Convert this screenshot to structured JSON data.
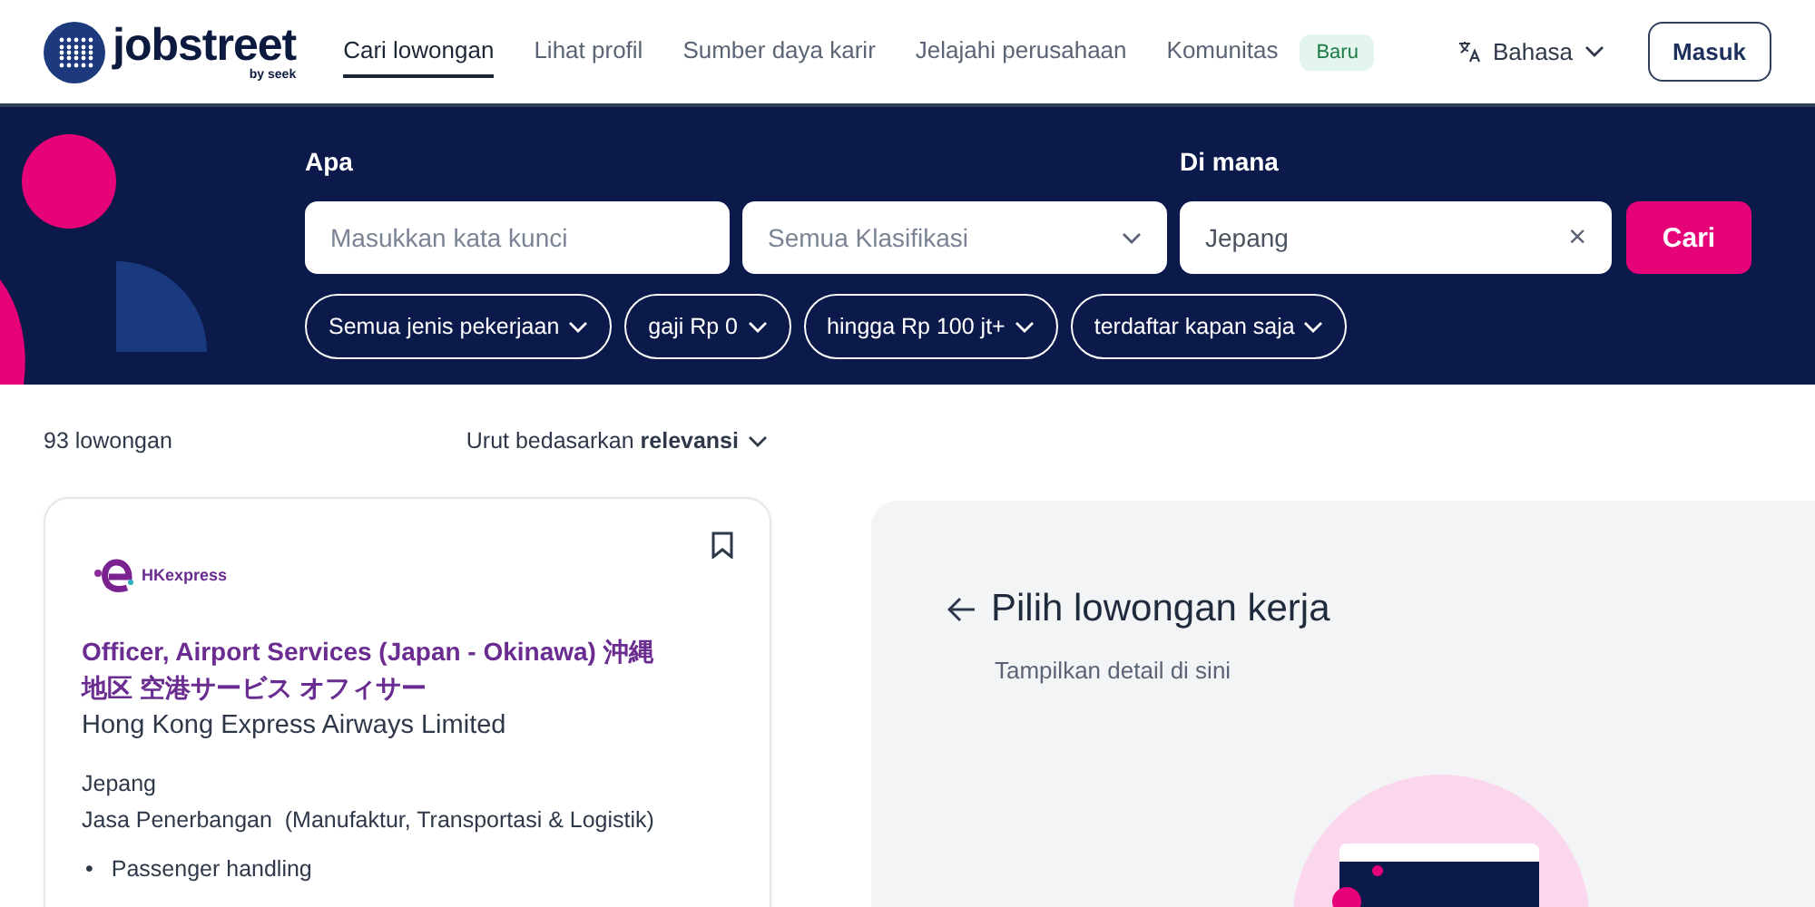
{
  "header": {
    "logo": {
      "name": "jobstreet",
      "tagline": "by seek"
    },
    "nav": [
      {
        "label": "Cari lowongan",
        "selected": true
      },
      {
        "label": "Lihat profil",
        "selected": false
      },
      {
        "label": "Sumber daya karir",
        "selected": false
      },
      {
        "label": "Jelajahi perusahaan",
        "selected": false
      },
      {
        "label": "Komunitas",
        "selected": false,
        "badge": "Baru"
      }
    ],
    "language": "Bahasa",
    "login": "Masuk"
  },
  "search": {
    "what_label": "Apa",
    "keyword": {
      "placeholder": "Masukkan kata kunci"
    },
    "classification": "Semua Klasifikasi",
    "where_label": "Di mana",
    "location": {
      "value": "Jepang"
    },
    "clear": "×",
    "submit": "Cari",
    "filters": [
      "Semua jenis pekerjaan",
      "gaji Rp 0",
      "hingga Rp 100 jt+",
      "terdaftar kapan saja"
    ]
  },
  "results": {
    "count": "93 lowongan",
    "sort": "Urut bedasarkan **relevansi**"
  },
  "jobs": [
    {
      "logo_text": "HKexpress",
      "title": "Officer, Airport Services (Japan - Okinawa) 沖縄地区 空港サービス オフィサー",
      "company": "Hong Kong Express Airways Limited",
      "location": "Jepang",
      "category": "Jasa Penerbangan  (Manufaktur, Transportasi & Logistik)",
      "bullets": [
        {
          "marker": "•",
          "text": "Passenger handling"
        }
      ]
    }
  ],
  "detail": {
    "title": "Pilih lowongan kerja",
    "subtitle": "Tampilkan detail di sini"
  }
}
